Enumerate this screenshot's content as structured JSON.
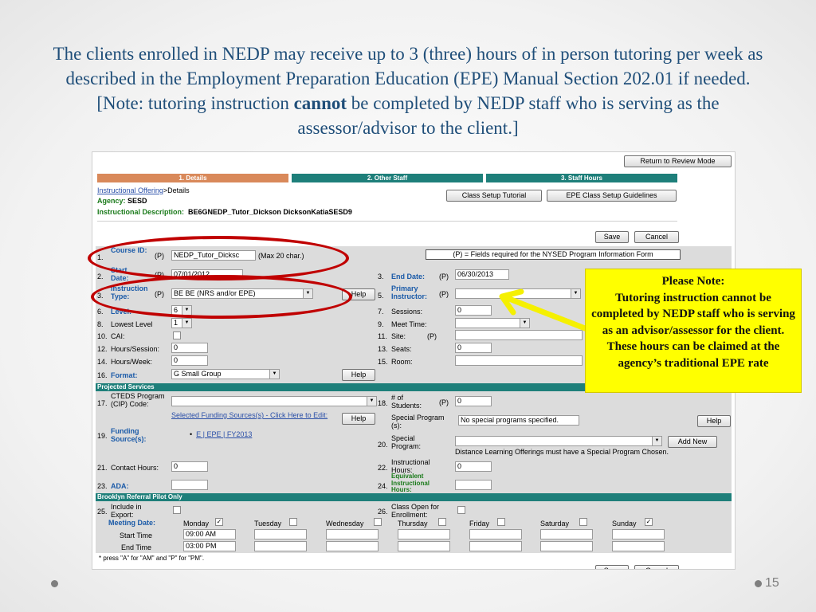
{
  "slide": {
    "heading_pre": "The clients enrolled in NEDP may receive up to 3 (three) hours of in person tutoring per week as described in the Employment Preparation Education (EPE) Manual Section 202.01 if needed. [Note: tutoring instruction ",
    "heading_bold": "cannot",
    "heading_post": " be completed by NEDP staff who is serving as the assessor/advisor to the client.]",
    "note_title": "Please Note:",
    "note_body": "Tutoring instruction cannot be completed by NEDP staff who is serving as an advisor/assessor for the client.  These hours can be claimed at the agency’s traditional EPE rate",
    "page_number": "15"
  },
  "app": {
    "return_btn": "Return to Review Mode",
    "tabs": [
      "1. Details",
      "2. Other Staff",
      "3. Staff Hours"
    ],
    "tab_colors": [
      "#d9895a",
      "#1e7f7a",
      "#1e7f7a"
    ],
    "breadcrumb_link": "Instructional Offering",
    "breadcrumb_rest": ">Details",
    "agency_label": "Agency:",
    "agency_value": "SESD",
    "desc_label": "Instructional Description:",
    "desc_value": "BE6GNEDP_Tutor_Dickson DicksonKatiaSESD9",
    "class_setup_btn": "Class Setup Tutorial",
    "epe_guidelines_btn": "EPE Class Setup Guidelines",
    "save_btn": "Save",
    "cancel_btn": "Cancel",
    "required_note": "(P) = Fields required for the NYSED Program Information Form",
    "help_btn": "Help",
    "add_new_btn": "Add New",
    "fields": {
      "course_id_label": "Course ID:",
      "course_id_value": "NEDP_Tutor_Dicksc",
      "course_id_hint": "(Max 20 char.)",
      "start_date_label": "Start Date:",
      "start_date_value": "07/01/2012",
      "end_date_label": "End Date:",
      "end_date_value": "06/30/2013",
      "instr_type_label": "Instruction Type:",
      "instr_type_value": "BE BE (NRS and/or EPE)",
      "primary_instr_label": "Primary Instructor:",
      "level_label": "Level:",
      "level_value": "6",
      "sessions_label": "Sessions:",
      "sessions_value": "0",
      "lowest_level_label": "Lowest Level",
      "lowest_level_value": "1",
      "meet_time_label": "Meet Time:",
      "cai_label": "CAI:",
      "site_label": "Site:",
      "hours_session_label": "Hours/Session:",
      "hours_session_value": "0",
      "seats_label": "Seats:",
      "seats_value": "0",
      "hours_week_label": "Hours/Week:",
      "hours_week_value": "0",
      "room_label": "Room:",
      "format_label": "Format:",
      "format_value": "G Small Group",
      "p_marker": "(P)"
    },
    "projected_services": "Projected Services",
    "cip_label": "CTEDS Program (CIP) Code:",
    "num_students_label": "# of Students:",
    "num_students_value": "0",
    "funding_link": "Selected Funding Sources(s) - Click Here to Edit:",
    "funding_label": "Funding Source(s):",
    "funding_item": "E | EPE | FY2013",
    "special_programs_label": "Special Program (s):",
    "special_programs_value": "No special programs specified.",
    "special_program_label": "Special Program:",
    "distance_note": "Distance Learning Offerings must have a Special Program Chosen.",
    "contact_hours_label": "Contact Hours:",
    "contact_hours_value": "0",
    "instr_hours_label": "Instructional Hours:",
    "instr_hours_value": "0",
    "ada_label": "ADA:",
    "equiv_hours_label": "Equivalent Instructional Hours:",
    "brooklyn_band": "Brooklyn Referral Pilot Only",
    "include_export_label": "Include in Export:",
    "class_open_label": "Class Open for Enrollment:",
    "meeting_date_label": "Meeting Date:",
    "days": [
      "Monday",
      "Tuesday",
      "Wednesday",
      "Thursday",
      "Friday",
      "Saturday",
      "Sunday"
    ],
    "days_checked": [
      true,
      false,
      false,
      false,
      false,
      false,
      true
    ],
    "start_time_label": "Start Time",
    "end_time_label": "End Time",
    "start_time_value": "09:00 AM",
    "end_time_value": "03:00 PM",
    "ampm_note": "* press \"A\" for \"AM\" and \"P\" for \"PM\".",
    "row_numbers": [
      "1.",
      "2.",
      "3.",
      "4.",
      "5.",
      "6.",
      "7.",
      "8.",
      "9.",
      "10.",
      "11.",
      "12.",
      "13.",
      "14.",
      "15.",
      "16.",
      "17.",
      "18.",
      "19.",
      "20.",
      "21.",
      "22.",
      "23.",
      "24.",
      "25.",
      "26."
    ]
  }
}
